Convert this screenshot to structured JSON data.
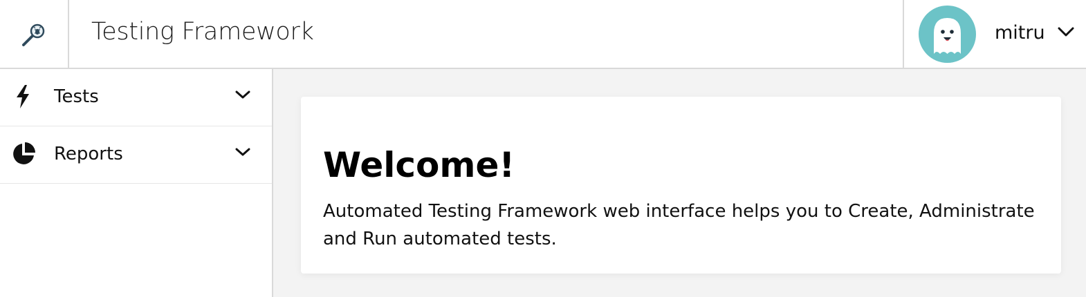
{
  "header": {
    "logo_icon": "magnifier-bug-icon",
    "app_title": "Testing Framework",
    "user": {
      "avatar_icon": "ghost-avatar",
      "name": "mitru",
      "chevron_icon": "chevron-down-icon"
    }
  },
  "sidebar": {
    "items": [
      {
        "label": "Tests",
        "icon": "lightning-icon"
      },
      {
        "label": "Reports",
        "icon": "pie-chart-icon"
      }
    ]
  },
  "main": {
    "heading": "Welcome!",
    "description": "Automated Testing Framework web interface helps you to Create, Administrate and Run automated tests."
  },
  "colors": {
    "avatar_bg": "#6cc3c7",
    "border": "#d9d9d9",
    "main_bg": "#f3f3f3"
  }
}
